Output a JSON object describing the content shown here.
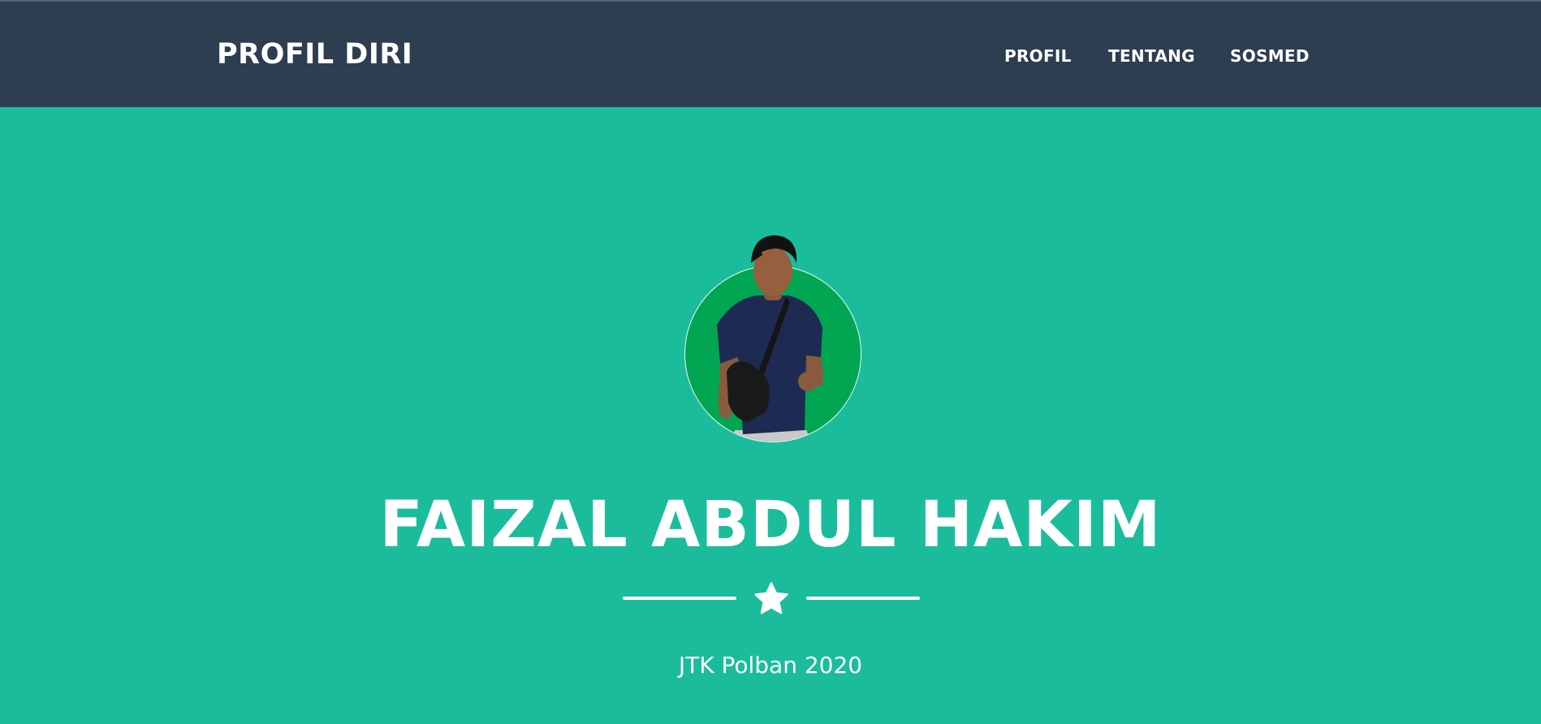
{
  "navbar": {
    "brand": "PROFIL DIRI",
    "links": [
      {
        "label": "PROFIL"
      },
      {
        "label": "TENTANG"
      },
      {
        "label": "SOSMED"
      }
    ]
  },
  "masthead": {
    "name": "FAIZAL ABDUL HAKIM",
    "subtitle": "JTK Polban 2020",
    "divider_icon": "star-icon"
  },
  "colors": {
    "navbar_bg": "#2c3e50",
    "masthead_bg": "#1abc9c",
    "avatar_bg": "#00a651",
    "text": "#ffffff"
  }
}
